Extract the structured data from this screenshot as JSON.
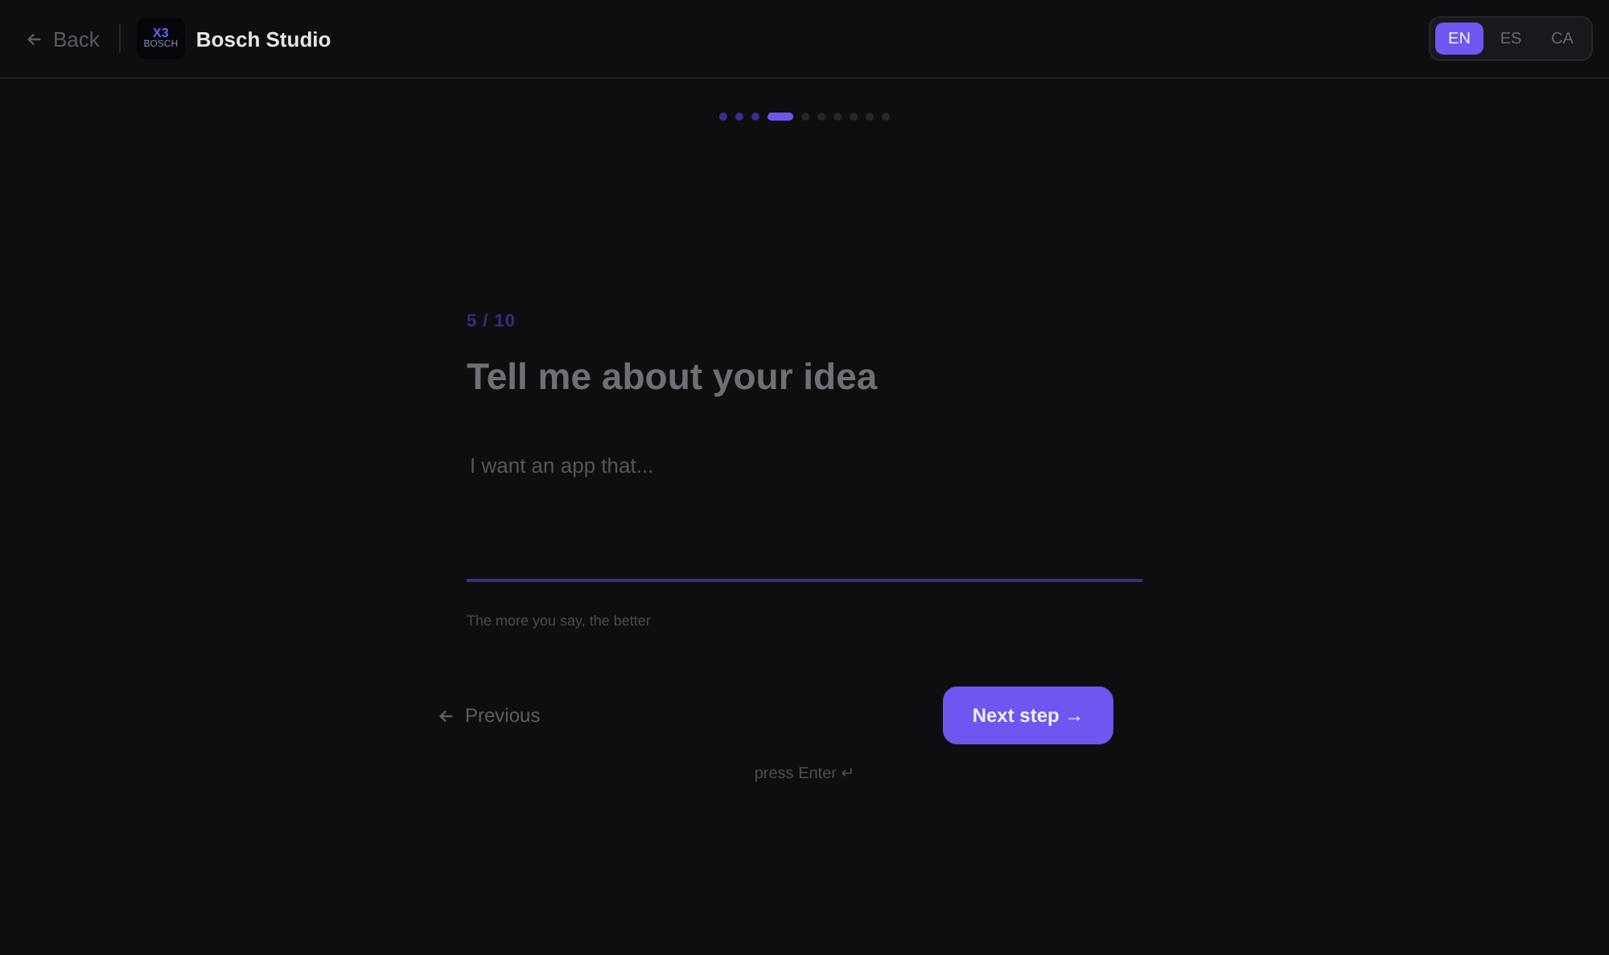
{
  "header": {
    "back": "Back",
    "logo": {
      "mark": "X3",
      "caption": "BOSCH"
    },
    "title": "Bosch Studio",
    "languages": [
      {
        "label": "EN",
        "selected": true
      },
      {
        "label": "ES",
        "selected": false
      },
      {
        "label": "CA",
        "selected": false
      }
    ]
  },
  "progress": [
    {
      "completed": true,
      "selected": false
    },
    {
      "completed": true,
      "selected": false
    },
    {
      "completed": true,
      "selected": false
    },
    {
      "completed": false,
      "selected": true
    },
    {
      "completed": false,
      "selected": false
    },
    {
      "completed": false,
      "selected": false
    },
    {
      "completed": false,
      "selected": false
    },
    {
      "completed": false,
      "selected": false
    },
    {
      "completed": false,
      "selected": false
    },
    {
      "completed": false,
      "selected": false
    }
  ],
  "step": "5 / 10",
  "question": "Tell me about your idea",
  "answer": {
    "placeholder": "I want an app that..."
  },
  "hint": "The more you say, the better",
  "previous": "Previous",
  "next": "Next step →",
  "enter_hint": "press Enter ↵"
}
